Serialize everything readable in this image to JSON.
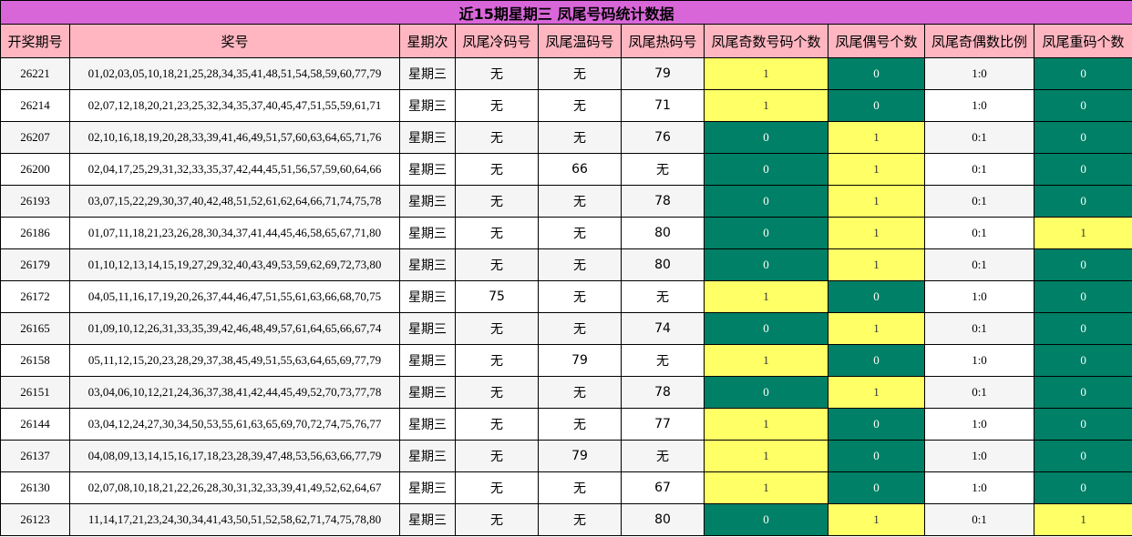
{
  "title": "近15期星期三 凤尾号码统计数据",
  "colors": {
    "title_bg": "#d966d9",
    "header_bg": "#ffb6c1",
    "highlight_yellow": "#ffff66",
    "highlight_green": "#008066"
  },
  "headers": [
    "开奖期号",
    "奖号",
    "星期次",
    "凤尾冷码号",
    "凤尾温码号",
    "凤尾热码号",
    "凤尾奇数号码个数",
    "凤尾偶号个数",
    "凤尾奇偶数比例",
    "凤尾重码个数"
  ],
  "rows": [
    {
      "period": "26221",
      "numbers": "01,02,03,05,10,18,21,25,28,34,35,41,48,51,54,58,59,60,77,79",
      "weekday": "星期三",
      "cold": "无",
      "warm": "无",
      "hot": "79",
      "odd_count": "1",
      "even_count": "0",
      "ratio": "1:0",
      "repeat": "0"
    },
    {
      "period": "26214",
      "numbers": "02,07,12,18,20,21,23,25,32,34,35,37,40,45,47,51,55,59,61,71",
      "weekday": "星期三",
      "cold": "无",
      "warm": "无",
      "hot": "71",
      "odd_count": "1",
      "even_count": "0",
      "ratio": "1:0",
      "repeat": "0"
    },
    {
      "period": "26207",
      "numbers": "02,10,16,18,19,20,28,33,39,41,46,49,51,57,60,63,64,65,71,76",
      "weekday": "星期三",
      "cold": "无",
      "warm": "无",
      "hot": "76",
      "odd_count": "0",
      "even_count": "1",
      "ratio": "0:1",
      "repeat": "0"
    },
    {
      "period": "26200",
      "numbers": "02,04,17,25,29,31,32,33,35,37,42,44,45,51,56,57,59,60,64,66",
      "weekday": "星期三",
      "cold": "无",
      "warm": "66",
      "hot": "无",
      "odd_count": "0",
      "even_count": "1",
      "ratio": "0:1",
      "repeat": "0"
    },
    {
      "period": "26193",
      "numbers": "03,07,15,22,29,30,37,40,42,48,51,52,61,62,64,66,71,74,75,78",
      "weekday": "星期三",
      "cold": "无",
      "warm": "无",
      "hot": "78",
      "odd_count": "0",
      "even_count": "1",
      "ratio": "0:1",
      "repeat": "0"
    },
    {
      "period": "26186",
      "numbers": "01,07,11,18,21,23,26,28,30,34,37,41,44,45,46,58,65,67,71,80",
      "weekday": "星期三",
      "cold": "无",
      "warm": "无",
      "hot": "80",
      "odd_count": "0",
      "even_count": "1",
      "ratio": "0:1",
      "repeat": "1"
    },
    {
      "period": "26179",
      "numbers": "01,10,12,13,14,15,19,27,29,32,40,43,49,53,59,62,69,72,73,80",
      "weekday": "星期三",
      "cold": "无",
      "warm": "无",
      "hot": "80",
      "odd_count": "0",
      "even_count": "1",
      "ratio": "0:1",
      "repeat": "0"
    },
    {
      "period": "26172",
      "numbers": "04,05,11,16,17,19,20,26,37,44,46,47,51,55,61,63,66,68,70,75",
      "weekday": "星期三",
      "cold": "75",
      "warm": "无",
      "hot": "无",
      "odd_count": "1",
      "even_count": "0",
      "ratio": "1:0",
      "repeat": "0"
    },
    {
      "period": "26165",
      "numbers": "01,09,10,12,26,31,33,35,39,42,46,48,49,57,61,64,65,66,67,74",
      "weekday": "星期三",
      "cold": "无",
      "warm": "无",
      "hot": "74",
      "odd_count": "0",
      "even_count": "1",
      "ratio": "0:1",
      "repeat": "0"
    },
    {
      "period": "26158",
      "numbers": "05,11,12,15,20,23,28,29,37,38,45,49,51,55,63,64,65,69,77,79",
      "weekday": "星期三",
      "cold": "无",
      "warm": "79",
      "hot": "无",
      "odd_count": "1",
      "even_count": "0",
      "ratio": "1:0",
      "repeat": "0"
    },
    {
      "period": "26151",
      "numbers": "03,04,06,10,12,21,24,36,37,38,41,42,44,45,49,52,70,73,77,78",
      "weekday": "星期三",
      "cold": "无",
      "warm": "无",
      "hot": "78",
      "odd_count": "0",
      "even_count": "1",
      "ratio": "0:1",
      "repeat": "0"
    },
    {
      "period": "26144",
      "numbers": "03,04,12,24,27,30,34,50,53,55,61,63,65,69,70,72,74,75,76,77",
      "weekday": "星期三",
      "cold": "无",
      "warm": "无",
      "hot": "77",
      "odd_count": "1",
      "even_count": "0",
      "ratio": "1:0",
      "repeat": "0"
    },
    {
      "period": "26137",
      "numbers": "04,08,09,13,14,15,16,17,18,23,28,39,47,48,53,56,63,66,77,79",
      "weekday": "星期三",
      "cold": "无",
      "warm": "79",
      "hot": "无",
      "odd_count": "1",
      "even_count": "0",
      "ratio": "1:0",
      "repeat": "0"
    },
    {
      "period": "26130",
      "numbers": "02,07,08,10,18,21,22,26,28,30,31,32,33,39,41,49,52,62,64,67",
      "weekday": "星期三",
      "cold": "无",
      "warm": "无",
      "hot": "67",
      "odd_count": "1",
      "even_count": "0",
      "ratio": "1:0",
      "repeat": "0"
    },
    {
      "period": "26123",
      "numbers": "11,14,17,21,23,24,30,34,41,43,50,51,52,58,62,71,74,75,78,80",
      "weekday": "星期三",
      "cold": "无",
      "warm": "无",
      "hot": "80",
      "odd_count": "0",
      "even_count": "1",
      "ratio": "0:1",
      "repeat": "1"
    }
  ]
}
